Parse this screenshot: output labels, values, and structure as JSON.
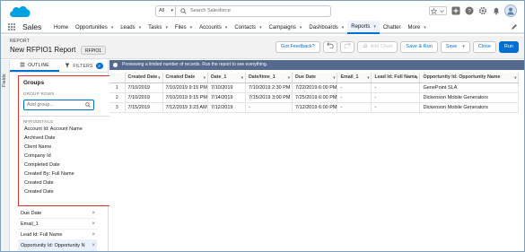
{
  "global_search": {
    "scope": "All",
    "placeholder": "Search Salesforce"
  },
  "app": {
    "name": "Sales",
    "nav": [
      {
        "label": "Home",
        "dropdown": false,
        "active": false
      },
      {
        "label": "Opportunities",
        "dropdown": true,
        "active": false
      },
      {
        "label": "Leads",
        "dropdown": true,
        "active": false
      },
      {
        "label": "Tasks",
        "dropdown": true,
        "active": false
      },
      {
        "label": "Files",
        "dropdown": true,
        "active": false
      },
      {
        "label": "Accounts",
        "dropdown": true,
        "active": false
      },
      {
        "label": "Contacts",
        "dropdown": true,
        "active": false
      },
      {
        "label": "Campaigns",
        "dropdown": true,
        "active": false
      },
      {
        "label": "Dashboards",
        "dropdown": true,
        "active": false
      },
      {
        "label": "Reports",
        "dropdown": true,
        "active": true
      },
      {
        "label": "Chatter",
        "dropdown": false,
        "active": false
      },
      {
        "label": "More",
        "dropdown": true,
        "active": false
      }
    ]
  },
  "report": {
    "label": "REPORT",
    "title": "New RFPIO1 Report",
    "pill": "RFPIO1",
    "buttons": {
      "feedback": "Got Feedback?",
      "add_chart": "Add Chart",
      "save_run": "Save & Run",
      "save": "Save",
      "close": "Close",
      "run": "Run"
    }
  },
  "panel": {
    "rail_label": "Fields",
    "tabs": {
      "outline": "OUTLINE",
      "filters": "FILTERS",
      "filters_count": "2"
    },
    "groups": {
      "heading": "Groups",
      "rows_label": "GROUP ROWS",
      "search_placeholder": "Add group...",
      "section_label": "RFPIODETAILS",
      "items": [
        "Account Id: Account Name",
        "Archived Date",
        "Client Name",
        "Company Id",
        "Completed Date",
        "Created By: Full Name",
        "Created Date",
        "Created Date"
      ]
    },
    "columns": [
      {
        "label": "Due Date",
        "selected": false
      },
      {
        "label": "Email_1",
        "selected": false
      },
      {
        "label": "Lead Id: Full Name",
        "selected": false
      },
      {
        "label": "Opportunity Id: Opportunity N",
        "selected": true
      }
    ]
  },
  "preview": {
    "message": "Previewing a limited number of records. Run the report to see everything.",
    "columns": [
      "",
      "Created Date",
      "Created Date",
      "Date_1",
      "Date/time_1",
      "Due Date",
      "Email_1",
      "Lead Id: Full Name",
      "Opportunity Id: Opportunity Name"
    ],
    "rows": [
      [
        "1",
        "7/10/2019",
        "7/10/2019 9:15 PM",
        "7/10/2019",
        "7/10/2019 2:30 PM",
        "7/22/2019 6:00 PM",
        "-",
        "-",
        "GenePoint SLA"
      ],
      [
        "2",
        "7/10/2019",
        "7/10/2019 9:15 PM",
        "7/14/2019",
        "7/15/2019 3:00 PM",
        "7/25/2019 6:00 PM",
        "-",
        "-",
        "Dickenson Mobile Generators"
      ],
      [
        "3",
        "7/15/2019",
        "7/12/2019 3:23 AM",
        "7/12/2019",
        "-",
        "7/12/2019 6:00 PM",
        "-",
        "-",
        "Dickenson Mobile Generators"
      ]
    ]
  },
  "colors": {
    "brand_blue": "#0070d2",
    "info_bar": "#54698d",
    "highlight_outline": "#d9342b",
    "header_bg": "#f3f2f2"
  }
}
